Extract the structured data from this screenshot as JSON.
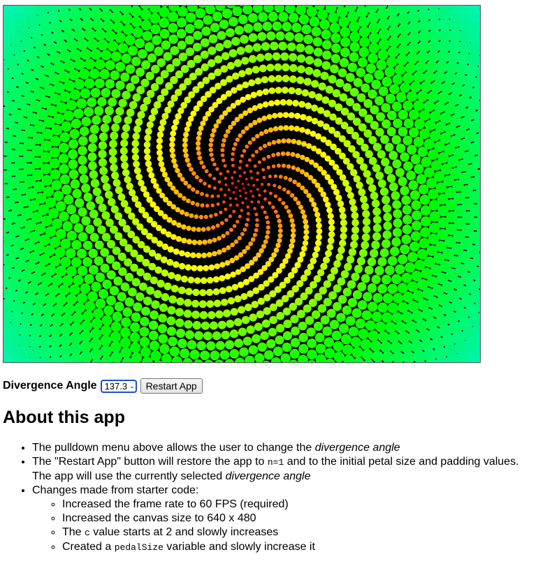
{
  "controls": {
    "divergence_label": "Divergence Angle",
    "divergence_value": "137.3",
    "restart_label": "Restart App"
  },
  "about": {
    "heading": "About this app",
    "item1_pre": "The pulldown menu above allows the user to change the ",
    "item1_em": "divergence angle",
    "item2_pre": "The \"Restart App\" button will restore the app to ",
    "item2_code": "n=1",
    "item2_mid": " and to the initial petal size and padding values. The app will use the currently selected ",
    "item2_em": "divergence angle",
    "item3": "Changes made from starter code:",
    "sub1": "Increased the frame rate to 60 FPS (required)",
    "sub2": "Increased the canvas size to 640 x 480",
    "sub3_pre": "The ",
    "sub3_code": "c",
    "sub3_post": " value starts at 2 and slowly increases",
    "sub4_pre": "Created a ",
    "sub4_code": "pedalSize",
    "sub4_post": " variable and slowly increase it"
  },
  "canvas": {
    "background": "#000000",
    "center_color": "#ff0000",
    "outer_color": "#00ffcc"
  }
}
